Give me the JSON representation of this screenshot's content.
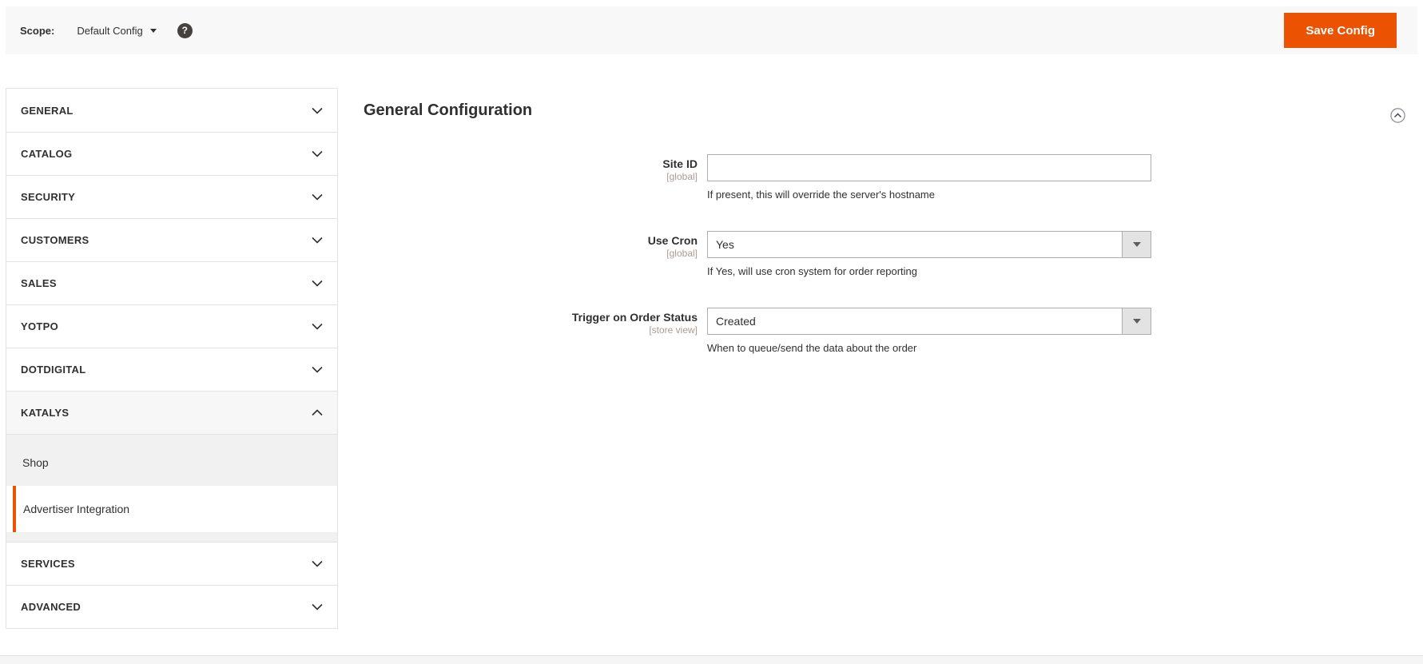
{
  "topbar": {
    "scope_label": "Scope:",
    "scope_value": "Default Config",
    "help_icon_glyph": "?",
    "save_button_label": "Save Config"
  },
  "sidebar": {
    "sections": [
      {
        "label": "GENERAL",
        "state": "collapsed"
      },
      {
        "label": "CATALOG",
        "state": "collapsed"
      },
      {
        "label": "SECURITY",
        "state": "collapsed"
      },
      {
        "label": "CUSTOMERS",
        "state": "collapsed"
      },
      {
        "label": "SALES",
        "state": "collapsed"
      },
      {
        "label": "YOTPO",
        "state": "collapsed"
      },
      {
        "label": "DOTDIGITAL",
        "state": "collapsed"
      },
      {
        "label": "KATALYS",
        "state": "expanded"
      },
      {
        "label": "SERVICES",
        "state": "collapsed"
      },
      {
        "label": "ADVANCED",
        "state": "collapsed"
      }
    ],
    "katalys_children": [
      {
        "label": "Shop",
        "active": false
      },
      {
        "label": "Advertiser Integration",
        "active": true
      }
    ]
  },
  "main": {
    "section_title": "General Configuration",
    "fields": [
      {
        "label": "Site ID",
        "scope": "[global]",
        "type": "text",
        "value": "",
        "note": "If present, this will override the server's hostname"
      },
      {
        "label": "Use Cron",
        "scope": "[global]",
        "type": "select",
        "value": "Yes",
        "note": "If Yes, will use cron system for order reporting"
      },
      {
        "label": "Trigger on Order Status",
        "scope": "[store view]",
        "type": "select",
        "value": "Created",
        "note": "When to queue/send the data about the order"
      }
    ]
  },
  "colors": {
    "accent": "#eb5202",
    "scope_bar_bg": "#f8f8f8",
    "border": "#e3e3e3",
    "input_border": "#adadad",
    "scope_hint": "#a79d95"
  }
}
